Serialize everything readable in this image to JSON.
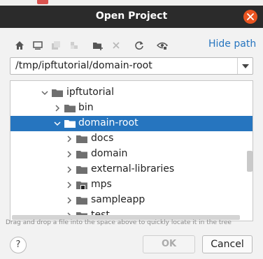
{
  "dialog": {
    "title": "Open Project"
  },
  "toolbar": {
    "hide_path_label": "Hide path",
    "icons": [
      "home-icon",
      "desktop-icon",
      "project-icon",
      "module-icon",
      "new-folder-icon",
      "delete-icon",
      "refresh-icon",
      "show-hidden-icon"
    ]
  },
  "path": {
    "value": "/tmp/ipftutorial/domain-root"
  },
  "tree": {
    "rows": [
      {
        "label": "ipftutorial",
        "expanded": true,
        "selected": false
      },
      {
        "label": "bin",
        "expanded": false,
        "selected": false
      },
      {
        "label": "domain-root",
        "expanded": true,
        "selected": true
      },
      {
        "label": "docs",
        "expanded": false,
        "selected": false
      },
      {
        "label": "domain",
        "expanded": false,
        "selected": false
      },
      {
        "label": "external-libraries",
        "expanded": false,
        "selected": false
      },
      {
        "label": "mps",
        "expanded": false,
        "selected": false
      },
      {
        "label": "sampleapp",
        "expanded": false,
        "selected": false
      },
      {
        "label": "test",
        "expanded": false,
        "selected": false
      }
    ]
  },
  "hint": "Drag and drop a file into the space above to quickly locate it in the tree",
  "buttons": {
    "help": "?",
    "ok": "OK",
    "cancel": "Cancel"
  },
  "colors": {
    "accent": "#2675bf",
    "close": "#e95420",
    "titlebar": "#2b2b2b"
  }
}
